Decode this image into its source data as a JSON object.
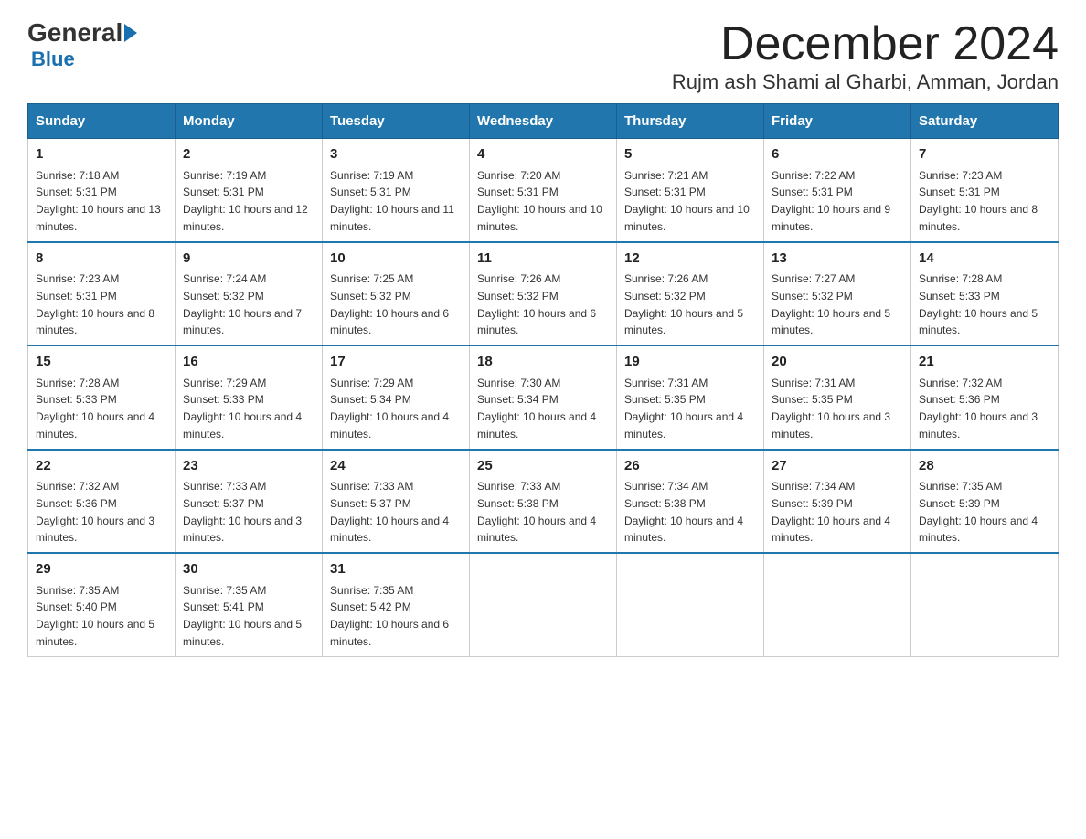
{
  "header": {
    "logo_general": "General",
    "logo_blue": "Blue",
    "month_title": "December 2024",
    "location": "Rujm ash Shami al Gharbi, Amman, Jordan"
  },
  "weekdays": [
    "Sunday",
    "Monday",
    "Tuesday",
    "Wednesday",
    "Thursday",
    "Friday",
    "Saturday"
  ],
  "weeks": [
    [
      {
        "day": "1",
        "sunrise": "7:18 AM",
        "sunset": "5:31 PM",
        "daylight": "10 hours and 13 minutes."
      },
      {
        "day": "2",
        "sunrise": "7:19 AM",
        "sunset": "5:31 PM",
        "daylight": "10 hours and 12 minutes."
      },
      {
        "day": "3",
        "sunrise": "7:19 AM",
        "sunset": "5:31 PM",
        "daylight": "10 hours and 11 minutes."
      },
      {
        "day": "4",
        "sunrise": "7:20 AM",
        "sunset": "5:31 PM",
        "daylight": "10 hours and 10 minutes."
      },
      {
        "day": "5",
        "sunrise": "7:21 AM",
        "sunset": "5:31 PM",
        "daylight": "10 hours and 10 minutes."
      },
      {
        "day": "6",
        "sunrise": "7:22 AM",
        "sunset": "5:31 PM",
        "daylight": "10 hours and 9 minutes."
      },
      {
        "day": "7",
        "sunrise": "7:23 AM",
        "sunset": "5:31 PM",
        "daylight": "10 hours and 8 minutes."
      }
    ],
    [
      {
        "day": "8",
        "sunrise": "7:23 AM",
        "sunset": "5:31 PM",
        "daylight": "10 hours and 8 minutes."
      },
      {
        "day": "9",
        "sunrise": "7:24 AM",
        "sunset": "5:32 PM",
        "daylight": "10 hours and 7 minutes."
      },
      {
        "day": "10",
        "sunrise": "7:25 AM",
        "sunset": "5:32 PM",
        "daylight": "10 hours and 6 minutes."
      },
      {
        "day": "11",
        "sunrise": "7:26 AM",
        "sunset": "5:32 PM",
        "daylight": "10 hours and 6 minutes."
      },
      {
        "day": "12",
        "sunrise": "7:26 AM",
        "sunset": "5:32 PM",
        "daylight": "10 hours and 5 minutes."
      },
      {
        "day": "13",
        "sunrise": "7:27 AM",
        "sunset": "5:32 PM",
        "daylight": "10 hours and 5 minutes."
      },
      {
        "day": "14",
        "sunrise": "7:28 AM",
        "sunset": "5:33 PM",
        "daylight": "10 hours and 5 minutes."
      }
    ],
    [
      {
        "day": "15",
        "sunrise": "7:28 AM",
        "sunset": "5:33 PM",
        "daylight": "10 hours and 4 minutes."
      },
      {
        "day": "16",
        "sunrise": "7:29 AM",
        "sunset": "5:33 PM",
        "daylight": "10 hours and 4 minutes."
      },
      {
        "day": "17",
        "sunrise": "7:29 AM",
        "sunset": "5:34 PM",
        "daylight": "10 hours and 4 minutes."
      },
      {
        "day": "18",
        "sunrise": "7:30 AM",
        "sunset": "5:34 PM",
        "daylight": "10 hours and 4 minutes."
      },
      {
        "day": "19",
        "sunrise": "7:31 AM",
        "sunset": "5:35 PM",
        "daylight": "10 hours and 4 minutes."
      },
      {
        "day": "20",
        "sunrise": "7:31 AM",
        "sunset": "5:35 PM",
        "daylight": "10 hours and 3 minutes."
      },
      {
        "day": "21",
        "sunrise": "7:32 AM",
        "sunset": "5:36 PM",
        "daylight": "10 hours and 3 minutes."
      }
    ],
    [
      {
        "day": "22",
        "sunrise": "7:32 AM",
        "sunset": "5:36 PM",
        "daylight": "10 hours and 3 minutes."
      },
      {
        "day": "23",
        "sunrise": "7:33 AM",
        "sunset": "5:37 PM",
        "daylight": "10 hours and 3 minutes."
      },
      {
        "day": "24",
        "sunrise": "7:33 AM",
        "sunset": "5:37 PM",
        "daylight": "10 hours and 4 minutes."
      },
      {
        "day": "25",
        "sunrise": "7:33 AM",
        "sunset": "5:38 PM",
        "daylight": "10 hours and 4 minutes."
      },
      {
        "day": "26",
        "sunrise": "7:34 AM",
        "sunset": "5:38 PM",
        "daylight": "10 hours and 4 minutes."
      },
      {
        "day": "27",
        "sunrise": "7:34 AM",
        "sunset": "5:39 PM",
        "daylight": "10 hours and 4 minutes."
      },
      {
        "day": "28",
        "sunrise": "7:35 AM",
        "sunset": "5:39 PM",
        "daylight": "10 hours and 4 minutes."
      }
    ],
    [
      {
        "day": "29",
        "sunrise": "7:35 AM",
        "sunset": "5:40 PM",
        "daylight": "10 hours and 5 minutes."
      },
      {
        "day": "30",
        "sunrise": "7:35 AM",
        "sunset": "5:41 PM",
        "daylight": "10 hours and 5 minutes."
      },
      {
        "day": "31",
        "sunrise": "7:35 AM",
        "sunset": "5:42 PM",
        "daylight": "10 hours and 6 minutes."
      },
      null,
      null,
      null,
      null
    ]
  ],
  "labels": {
    "sunrise": "Sunrise:",
    "sunset": "Sunset:",
    "daylight": "Daylight:"
  }
}
